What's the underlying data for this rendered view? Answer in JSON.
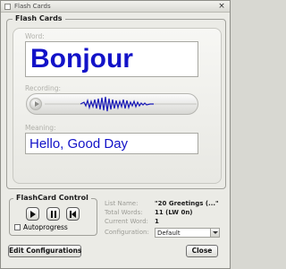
{
  "window": {
    "title": "Flash Cards"
  },
  "flash_cards": {
    "group_label": "Flash Cards",
    "word_label": "Word:",
    "word": "Bonjour",
    "recording_label": "Recording:",
    "meaning_label": "Meaning:",
    "meaning": "Hello, Good Day"
  },
  "flashcard_control": {
    "group_label": "FlashCard Control",
    "play_icon": "play-icon",
    "pause_icon": "pause-icon",
    "restart_icon": "skip-back-icon",
    "autoprogress_label": "Autoprogress",
    "autoprogress_checked": false
  },
  "info": {
    "list_name_label": "List Name:",
    "list_name": "\"20 Greetings (...\"",
    "total_words_label": "Total Words:",
    "total_words": "11 (LW 0n)",
    "current_word_label": "Current Word:",
    "current_word": "1",
    "configuration_label": "Configuration:",
    "configuration": "Default"
  },
  "buttons": {
    "edit_configurations": "Edit Configurations",
    "close": "Close"
  },
  "colors": {
    "accent_text": "#1212c8",
    "background": "#ebebe6"
  }
}
